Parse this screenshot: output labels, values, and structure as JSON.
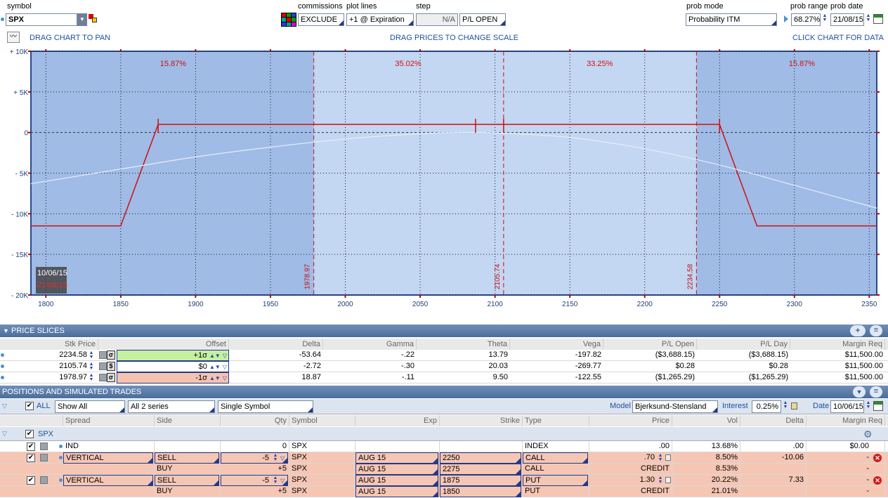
{
  "toolbar": {
    "symbol_label": "symbol",
    "symbol_value": "SPX",
    "commissions_label": "commissions",
    "commissions_value": "EXCLUDE",
    "plot_lines_label": "plot lines",
    "plot_lines_value": "+1 @ Expiration",
    "step_label": "step",
    "step_value": "N/A",
    "pl_value": "P/L OPEN",
    "prob_mode_label": "prob mode",
    "prob_mode_value": "Probability ITM",
    "prob_range_label": "prob range",
    "prob_range_value": "68.27%",
    "prob_date_label": "prob date",
    "prob_date_value": "21/08/15"
  },
  "hints": {
    "pan": "DRAG CHART TO PAN",
    "scale": "DRAG PRICES TO CHANGE SCALE",
    "data": "CLICK CHART FOR DATA"
  },
  "chart_data": {
    "type": "line",
    "xlim": [
      1790,
      2355
    ],
    "ylim": [
      -20000,
      10000
    ],
    "x_ticks": [
      "1800",
      "1850",
      "1900",
      "1950",
      "2000",
      "2050",
      "2100",
      "2150",
      "2200",
      "2250",
      "2300",
      "2350"
    ],
    "y_ticks": [
      "+ 10K",
      "+ 5K",
      "0",
      "- 5K",
      "- 10K",
      "- 15K",
      "- 20K"
    ],
    "x_tick_values": [
      1800,
      1850,
      1900,
      1950,
      2000,
      2050,
      2100,
      2150,
      2200,
      2250,
      2300,
      2350
    ],
    "y_tick_values": [
      10000,
      5000,
      0,
      -5000,
      -10000,
      -15000,
      -20000
    ],
    "probabilities": [
      {
        "label": "15.87%",
        "x": 1885
      },
      {
        "label": "35.02%",
        "x": 2042
      },
      {
        "label": "33.25%",
        "x": 2170
      },
      {
        "label": "15.87%",
        "x": 2305
      }
    ],
    "price_markers": [
      {
        "label": "1978.97",
        "x": 1978.97
      },
      {
        "label": "2105.74",
        "x": 2105.74
      },
      {
        "label": "2234.58",
        "x": 2234.58
      }
    ],
    "series": [
      {
        "values": [
          [
            1790,
            -11500
          ],
          [
            1850,
            -11500
          ],
          [
            1875,
            1000
          ],
          [
            2250,
            1000
          ],
          [
            2275,
            -11500
          ],
          [
            2355,
            -11500
          ]
        ]
      },
      {
        "values": [
          [
            1790,
            -6300
          ],
          [
            1850,
            -4500
          ],
          [
            1900,
            -3000
          ],
          [
            1950,
            -1800
          ],
          [
            2000,
            -800
          ],
          [
            2050,
            -150
          ],
          [
            2075,
            0
          ],
          [
            2100,
            -50
          ],
          [
            2150,
            -600
          ],
          [
            2200,
            -2000
          ],
          [
            2250,
            -4000
          ],
          [
            2300,
            -6500
          ],
          [
            2355,
            -9300
          ]
        ]
      }
    ],
    "shade_regions": [
      [
        1978.97,
        2234.58
      ]
    ],
    "date_box": {
      "line1": "10/06/15",
      "line2": "21/08/15"
    }
  },
  "price_slices": {
    "title": "PRICE SLICES",
    "headers": [
      "Stk Price",
      "Offset",
      "Delta",
      "Gamma",
      "Theta",
      "Vega",
      "P/L Open",
      "P/L Day",
      "Margin Req"
    ],
    "rows": [
      {
        "stk": "2234.58",
        "offset": "+1σ",
        "delta": "-53.64",
        "gamma": "-.22",
        "theta": "13.79",
        "vega": "-197.82",
        "plopen": "($3,688.15)",
        "plday": "($3,688.15)",
        "margin": "$11,500.00"
      },
      {
        "stk": "2105.74",
        "offset": "$0",
        "delta": "-2.72",
        "gamma": "-.30",
        "theta": "20.03",
        "vega": "-269.77",
        "plopen": "$0.28",
        "plday": "$0.28",
        "margin": "$11,500.00"
      },
      {
        "stk": "1978.97",
        "offset": "-1σ",
        "delta": "18.87",
        "gamma": "-.11",
        "theta": "9.50",
        "vega": "-122.55",
        "plopen": "($1,265.29)",
        "plday": "($1,265.29)",
        "margin": "$11,500.00"
      }
    ]
  },
  "positions": {
    "title": "POSITIONS AND SIMULATED TRADES",
    "all_label": "ALL",
    "show_all": "Show All",
    "series": "All 2 series",
    "single": "Single Symbol",
    "model_label": "Model",
    "model_value": "Bjerksund-Stensland",
    "interest_label": "Interest",
    "interest_value": "0.25%",
    "date_label": "Date",
    "date_value": "10/06/15",
    "headers": [
      "Spread",
      "Side",
      "Qty",
      "Symbol",
      "Exp",
      "Strike",
      "Type",
      "Price",
      "Vol",
      "Delta",
      "Margin Req"
    ],
    "group": "SPX",
    "rows": [
      {
        "spread": "IND",
        "side": "",
        "qty": "0",
        "symbol": "SPX",
        "exp": "",
        "strike": "",
        "type": "INDEX",
        "price": ".00",
        "vol": "13.68%",
        "delta": ".00",
        "margin": "$0.00"
      },
      {
        "spread": "VERTICAL",
        "side": "SELL",
        "qty": "-5",
        "symbol": "SPX",
        "exp": "AUG 15",
        "strike": "2250",
        "type": "CALL",
        "price": ".70",
        "vol": "8.50%",
        "delta": "-10.06",
        "margin": "-"
      },
      {
        "spread": "",
        "side": "BUY",
        "qty": "+5",
        "symbol": "SPX",
        "exp": "AUG 15",
        "strike": "2275",
        "type": "CALL",
        "price": "CREDIT",
        "vol": "8.53%",
        "delta": "",
        "margin": "-"
      },
      {
        "spread": "VERTICAL",
        "side": "SELL",
        "qty": "-5",
        "symbol": "SPX",
        "exp": "AUG 15",
        "strike": "1875",
        "type": "PUT",
        "price": "1.30",
        "vol": "20.22%",
        "delta": "7.33",
        "margin": "-"
      },
      {
        "spread": "",
        "side": "BUY",
        "qty": "+5",
        "symbol": "SPX",
        "exp": "AUG 15",
        "strike": "1850",
        "type": "PUT",
        "price": "CREDIT",
        "vol": "21.01%",
        "delta": "",
        "margin": "-"
      }
    ]
  }
}
